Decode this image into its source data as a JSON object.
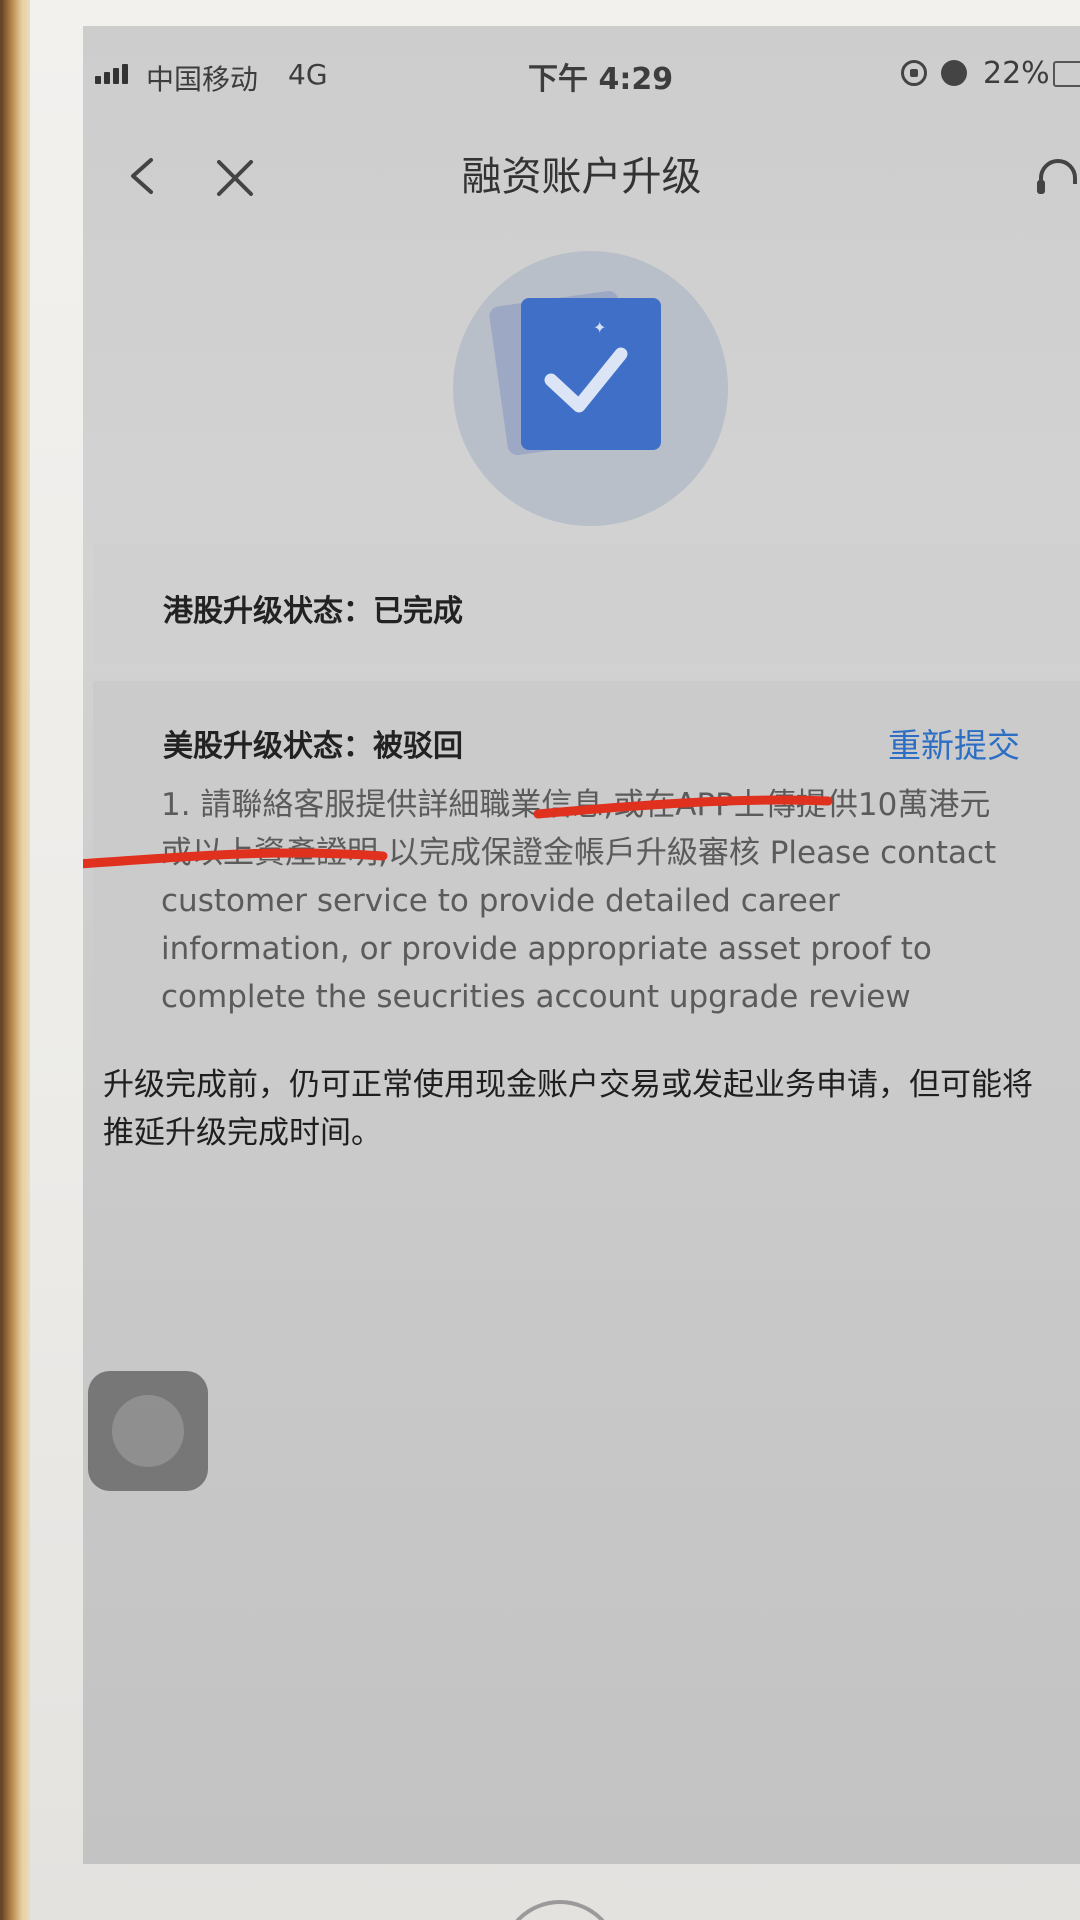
{
  "status_bar": {
    "carrier": "中国移动",
    "network": "4G",
    "time": "下午 4:29",
    "battery": "22%"
  },
  "nav": {
    "title": "融资账户升级",
    "icons": [
      "back-icon",
      "close-icon",
      "headset-icon"
    ]
  },
  "hero": {
    "icon": "checkmark-card-icon",
    "accent_color": "#3f6fc6"
  },
  "hk_status": {
    "label": "港股升级状态：已完成"
  },
  "us_status": {
    "label": "美股升级状态：被驳回",
    "resubmit_label": "重新提交",
    "reason": "1. 請聯絡客服提供詳細職業信息,或在APP上傳提供10萬港元或以上資產證明,以完成保證金帳戶升級審核 Please contact customer service to provide detailed career information, or provide appropriate asset proof to complete the seucrities account upgrade review"
  },
  "note": "升级完成前，仍可正常使用现金账户交易或发起业务申请，但可能将推延升级完成时间。",
  "colors": {
    "link": "#2c6ec4",
    "annotation": "#e0301e"
  }
}
